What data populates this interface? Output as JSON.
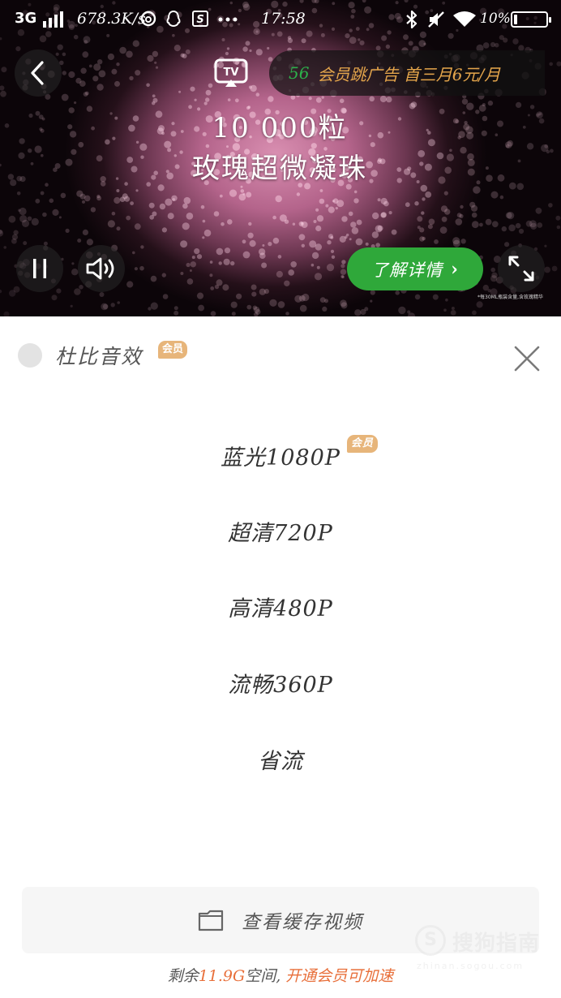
{
  "status_bar": {
    "network": "3G",
    "speed": "678.3K/s",
    "time": "17:58",
    "battery_percent": "10%",
    "battery_level": 0.1,
    "left_icons": [
      "signal-icon",
      "netease-music-icon",
      "qq-icon",
      "s-app-icon",
      "more-dots-icon"
    ],
    "right_icons": [
      "bluetooth-icon",
      "mute-icon",
      "wifi-icon",
      "battery-icon"
    ]
  },
  "player": {
    "promo_number": "56",
    "promo_text": "会员跳广告 首三月6元/月",
    "overlay_line1": "10 000粒",
    "overlay_line2": "玫瑰超微凝珠",
    "learn_more": "了解详情",
    "fine_print": "*每30ML瓶装含量,含玫瑰精华",
    "icons": [
      "back-arrow-icon",
      "tv-cast-icon",
      "pause-icon",
      "volume-icon",
      "fullscreen-icon"
    ]
  },
  "quality_panel": {
    "dolby_label": "杜比音效",
    "vip_badge": "会员",
    "options": [
      {
        "label": "蓝光1080P",
        "vip": true
      },
      {
        "label": "超清720P",
        "vip": false
      },
      {
        "label": "高清480P",
        "vip": false
      },
      {
        "label": "流畅360P",
        "vip": false
      },
      {
        "label": "省流",
        "vip": false
      }
    ],
    "cache_button": "查看缓存视频",
    "storage": {
      "prefix": "剩余",
      "amount": "11.9G",
      "middle": "空间,",
      "upgrade_link": "开通会员可加速"
    }
  },
  "watermark": {
    "logo_letter": "S",
    "text": "搜狗指南",
    "url": "zhinan.sogou.com"
  },
  "colors": {
    "accent_green": "#2fa83a",
    "promo_gold": "#e4a54b",
    "vip_badge": "#e7b57a",
    "highlight_orange": "#e86f3a"
  }
}
